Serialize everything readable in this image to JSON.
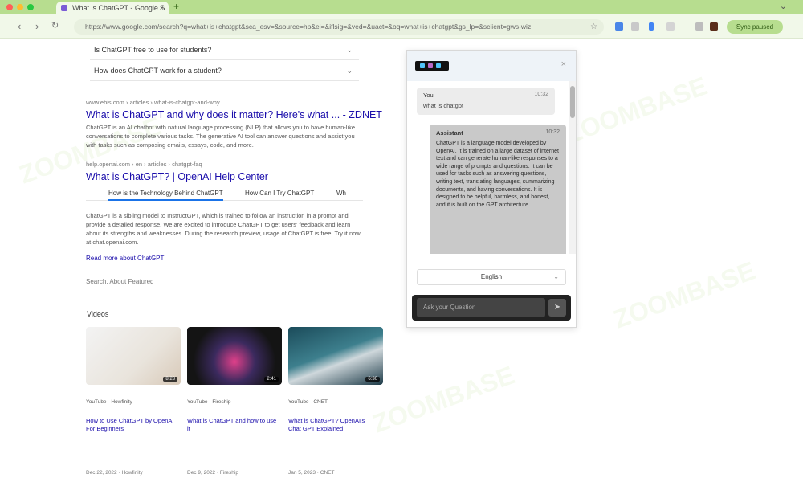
{
  "browser": {
    "tab_title": "What is ChatGPT - Google S",
    "url": "https://www.google.com/search?q=what+is+chatgpt&sca_esv=&source=hp&ei=&iflsig=&ved=&uact=&oq=what+is+chatgpt&gs_lp=&sclient=gws-wiz",
    "profile_label": "Sync paused",
    "colors": {
      "tabbar": "#b7dd8f",
      "toolbar": "#f1f8e9"
    }
  },
  "paa": [
    {
      "question": "Is ChatGPT free to use for students?"
    },
    {
      "question": "How does ChatGPT work for a student?"
    }
  ],
  "results": [
    {
      "meta": "www.ebis.com › articles › what-is-chatgpt-and-why",
      "title": "What is ChatGPT and why does it matter? Here's what ... - ZDNET",
      "snippet": "ChatGPT is an AI chatbot with natural language processing (NLP) that allows you to have human-like conversations to complete various tasks. The generative AI tool can answer questions and assist you with tasks such as composing emails, essays, code, and more."
    },
    {
      "meta": "help.openai.com › en › articles › chatgpt-faq",
      "title": "What is ChatGPT? | OpenAI Help Center",
      "snippet": "ChatGPT is a sibling model to InstructGPT, which is trained to follow an instruction in a prompt and provide a detailed response. We are excited to introduce ChatGPT to get users' feedback and learn about its strengths and weaknesses. During the research preview, usage of ChatGPT is free. Try it now at chat.openai.com."
    }
  ],
  "subtabs": [
    "How is the Technology Behind ChatGPT",
    "How Can I Try ChatGPT",
    "Wh"
  ],
  "more_link": "Read more about ChatGPT",
  "feedback": "Search, About Featured",
  "videos": {
    "heading": "Videos",
    "items": [
      {
        "source": "YouTube · Howfinity",
        "title": "How to Use ChatGPT by OpenAI For Beginners",
        "duration": "8:23",
        "date": "Dec 22, 2022 · Howfinity"
      },
      {
        "source": "YouTube · Fireship",
        "title": "What is ChatGPT and how to use it",
        "duration": "2:41",
        "date": "Dec 9, 2022 · Fireship"
      },
      {
        "source": "YouTube · CNET",
        "title": "What is ChatGPT? OpenAI's Chat GPT Explained",
        "duration": "6:30",
        "date": "Jan 5, 2023 · CNET"
      }
    ]
  },
  "popup": {
    "close": "×",
    "user_msg": {
      "who": "You",
      "time": "10:32",
      "text": "what is chatgpt"
    },
    "bot_msg": {
      "who": "Assistant",
      "time": "10:32",
      "text": "ChatGPT is a language model developed by OpenAI. It is trained on a large dataset of internet text and can generate human-like responses to a wide range of prompts and questions. It can be used for tasks such as answering questions, writing text, translating languages, summarizing documents, and having conversations. It is designed to be helpful, harmless, and honest, and it is built on the GPT architecture."
    },
    "language": "English",
    "input_placeholder": "Ask your Question"
  },
  "watermark": "ZOOMBASE"
}
